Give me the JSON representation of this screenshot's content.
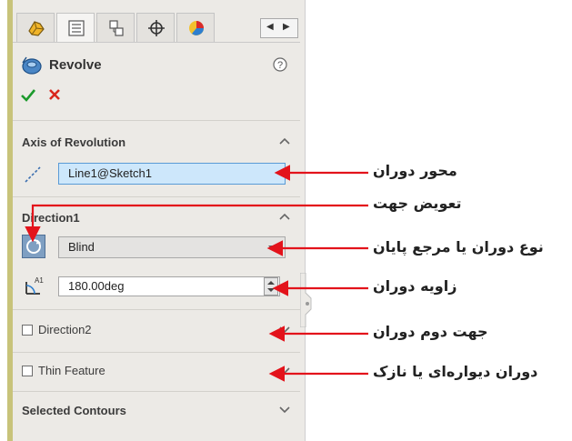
{
  "panel": {
    "title": "Revolve",
    "tabs": [
      "feature-manager-icon",
      "property-manager-icon",
      "configuration-manager-icon",
      "dimxpert-icon",
      "display-manager-icon"
    ],
    "sections": {
      "axis": {
        "title": "Axis of Revolution",
        "value": "Line1@Sketch1"
      },
      "direction1": {
        "title": "Direction1",
        "type_value": "Blind",
        "angle_value": "180.00deg"
      },
      "direction2": {
        "title": "Direction2",
        "checked": false
      },
      "thin_feature": {
        "title": "Thin Feature",
        "checked": false
      },
      "selected_contours": {
        "title": "Selected Contours"
      }
    }
  },
  "annotations": {
    "axis": "محور دوران",
    "reverse": "تعویض جهت",
    "type": "نوع دوران یا مرجع پایان",
    "angle": "زاویه دوران",
    "direction2": "جهت دوم دوران",
    "thin": "دوران دیواره‌ای یا نازک"
  },
  "colors": {
    "arrow": "#e3131b",
    "ok": "#1c9a2c",
    "cancel": "#d9261c",
    "selection": "#cde7fb"
  }
}
